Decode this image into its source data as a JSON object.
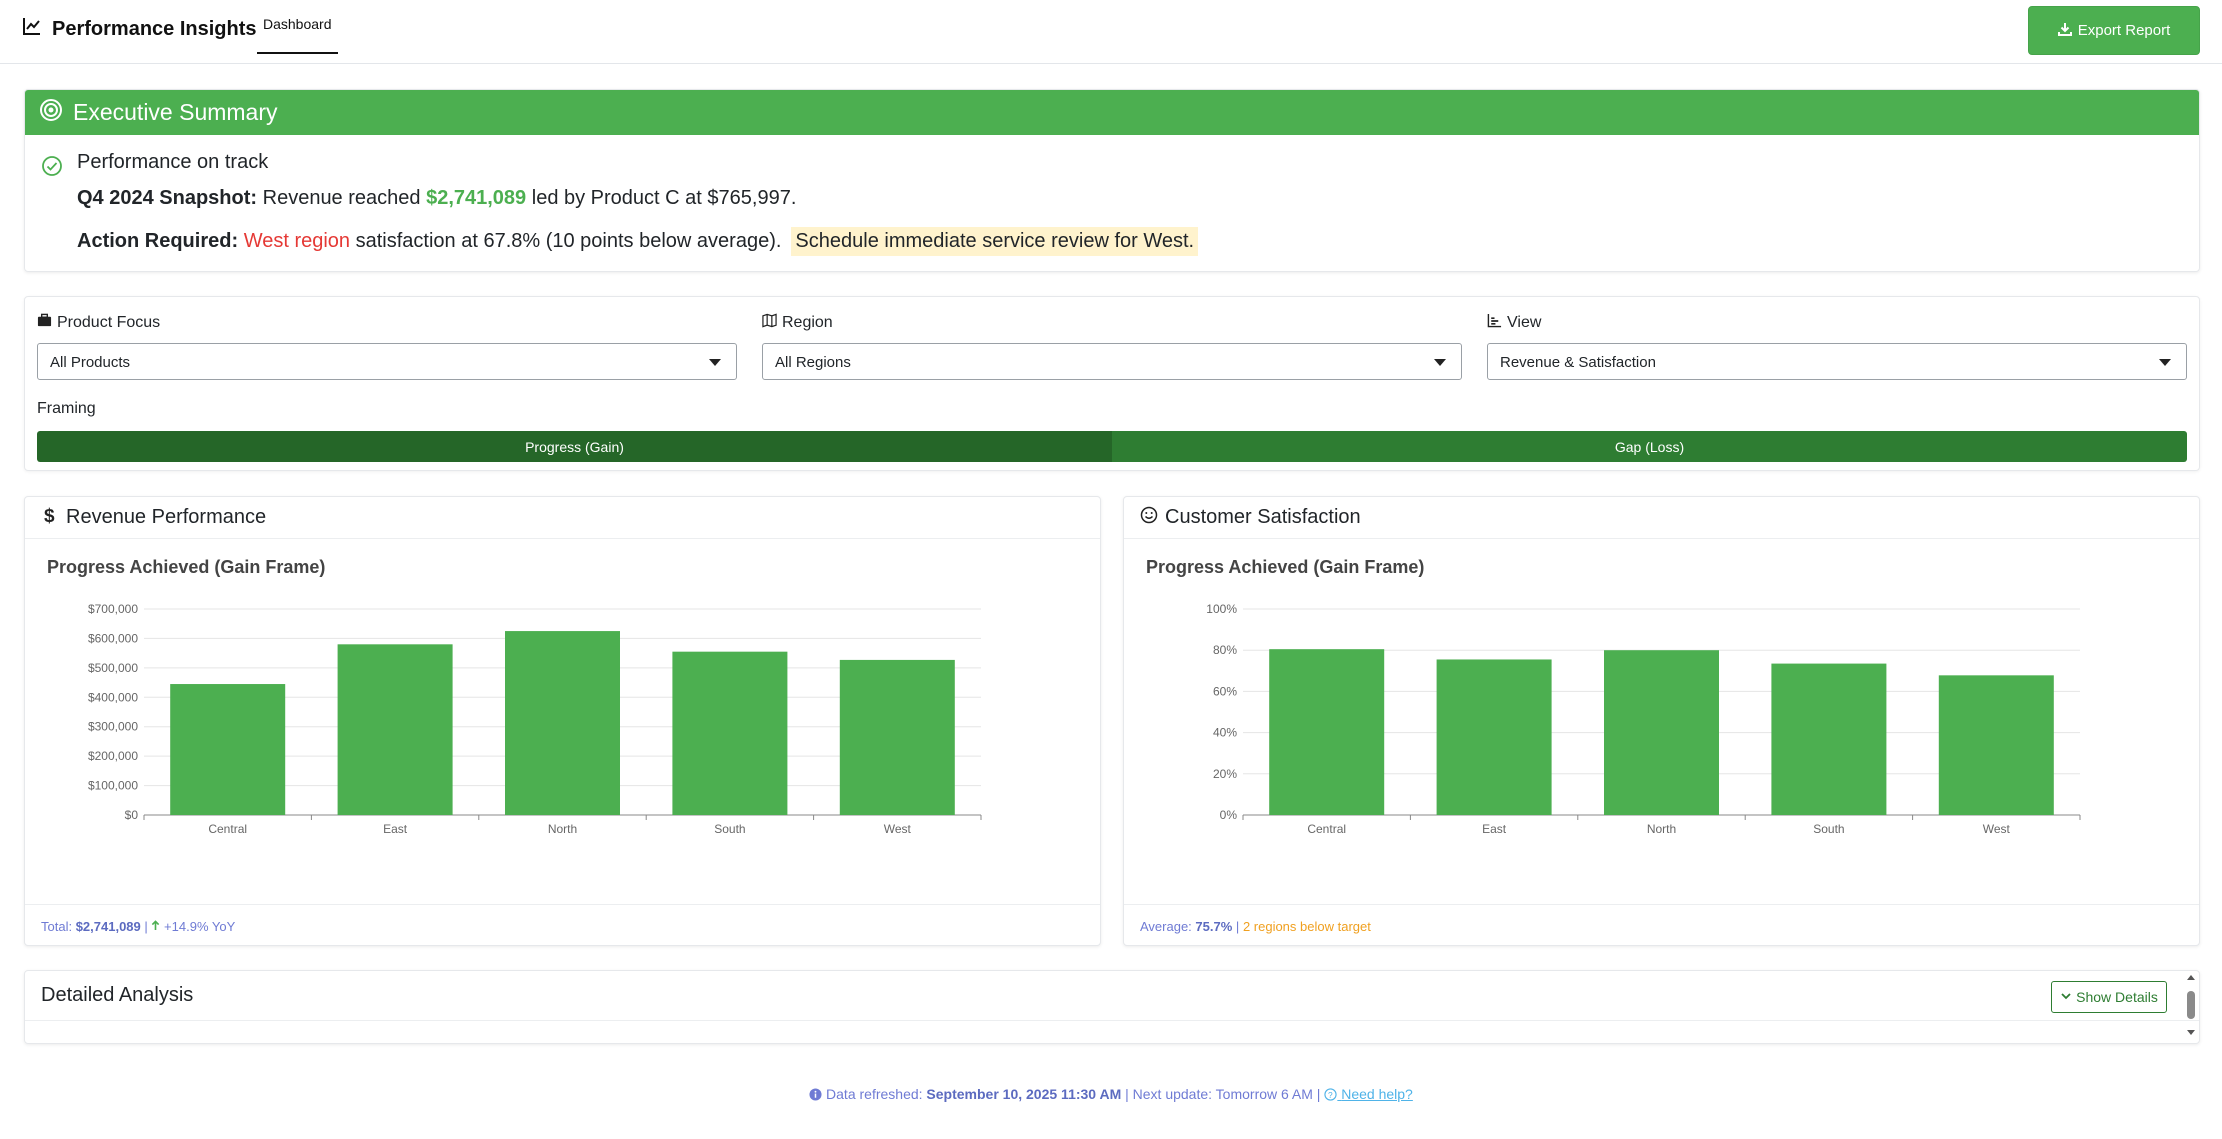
{
  "header": {
    "title": "Performance Insights",
    "tab": "Dashboard",
    "export_label": "Export Report"
  },
  "summary": {
    "title": "Executive Summary",
    "status": "Performance on track",
    "snapshot_label": "Q4 2024 Snapshot:",
    "snapshot_pre": "Revenue reached",
    "snapshot_value": "$2,741,089",
    "snapshot_post": "led by Product C at $765,997.",
    "action_label": "Action Required:",
    "action_region": "West region",
    "action_text": "satisfaction at 67.8% (10 points below average).",
    "action_highlight": "Schedule immediate service review for West."
  },
  "filters": {
    "product_label": "Product Focus",
    "product_value": "All Products",
    "region_label": "Region",
    "region_value": "All Regions",
    "view_label": "View",
    "view_value": "Revenue & Satisfaction",
    "framing_label": "Framing",
    "framing_options": [
      "Progress (Gain)",
      "Gap (Loss)"
    ]
  },
  "revenue_card": {
    "title": "Revenue Performance",
    "chart_title": "Progress Achieved (Gain Frame)",
    "footer_label": "Total:",
    "footer_value": "$2,741,089",
    "footer_sep": "|",
    "footer_trend": "+14.9% YoY"
  },
  "satisfaction_card": {
    "title": "Customer Satisfaction",
    "chart_title": "Progress Achieved (Gain Frame)",
    "footer_label": "Average:",
    "footer_value": "75.7%",
    "footer_sep": "|",
    "footer_alert": "2 regions below target"
  },
  "detail": {
    "title": "Detailed Analysis",
    "button_label": "Show Details"
  },
  "footer": {
    "refreshed_label": "Data refreshed:",
    "refreshed_value": "September 10, 2025 11:30 AM",
    "next_update": "| Next update: Tomorrow 6 AM |",
    "help": "Need help?"
  },
  "colors": {
    "accent": "#4caf50",
    "dark_green": "#2e7d32",
    "alert_red": "#e53935",
    "highlight": "#fff3cd",
    "bar": "#4caf50"
  },
  "chart_data": [
    {
      "type": "bar",
      "title": "Progress Achieved (Gain Frame)",
      "categories": [
        "Central",
        "East",
        "North",
        "South",
        "West"
      ],
      "values": [
        445000,
        580000,
        625000,
        555000,
        527000
      ],
      "ylim": [
        0,
        700000
      ],
      "yticks": [
        "$0",
        "$100,000",
        "$200,000",
        "$300,000",
        "$400,000",
        "$500,000",
        "$600,000",
        "$700,000"
      ],
      "grid": true
    },
    {
      "type": "bar",
      "title": "Progress Achieved (Gain Frame)",
      "categories": [
        "Central",
        "East",
        "North",
        "South",
        "West"
      ],
      "values": [
        80.5,
        75.5,
        80,
        73.5,
        67.8
      ],
      "ylim": [
        0,
        100
      ],
      "yticks": [
        "0%",
        "20%",
        "40%",
        "60%",
        "80%",
        "100%"
      ],
      "grid": true
    }
  ]
}
